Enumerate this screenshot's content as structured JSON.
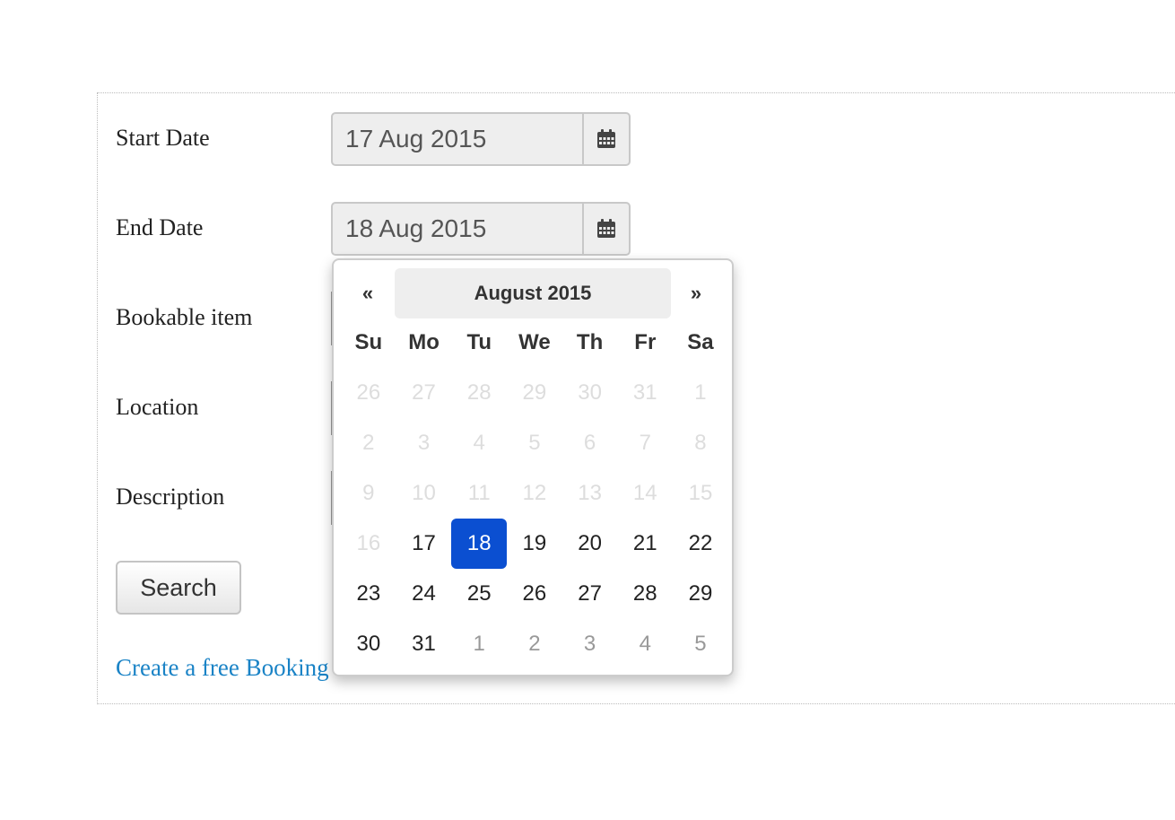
{
  "form": {
    "start_date_label": "Start Date",
    "start_date_value": "17 Aug 2015",
    "end_date_label": "End Date",
    "end_date_value": "18 Aug 2015",
    "bookable_item_label": "Bookable item",
    "location_label": "Location",
    "description_label": "Description",
    "search_label": "Search",
    "create_link_text": "Create a free Booking"
  },
  "datepicker": {
    "prev": "«",
    "next": "»",
    "month_title": "August 2015",
    "days_of_week": [
      "Su",
      "Mo",
      "Tu",
      "We",
      "Th",
      "Fr",
      "Sa"
    ],
    "selected_day": "18",
    "accent_color": "#0b4fd1",
    "weeks": [
      [
        {
          "d": "26",
          "s": "disabled"
        },
        {
          "d": "27",
          "s": "disabled"
        },
        {
          "d": "28",
          "s": "disabled"
        },
        {
          "d": "29",
          "s": "disabled"
        },
        {
          "d": "30",
          "s": "disabled"
        },
        {
          "d": "31",
          "s": "disabled"
        },
        {
          "d": "1",
          "s": "disabled"
        }
      ],
      [
        {
          "d": "2",
          "s": "disabled"
        },
        {
          "d": "3",
          "s": "disabled"
        },
        {
          "d": "4",
          "s": "disabled"
        },
        {
          "d": "5",
          "s": "disabled"
        },
        {
          "d": "6",
          "s": "disabled"
        },
        {
          "d": "7",
          "s": "disabled"
        },
        {
          "d": "8",
          "s": "disabled"
        }
      ],
      [
        {
          "d": "9",
          "s": "disabled"
        },
        {
          "d": "10",
          "s": "disabled"
        },
        {
          "d": "11",
          "s": "disabled"
        },
        {
          "d": "12",
          "s": "disabled"
        },
        {
          "d": "13",
          "s": "disabled"
        },
        {
          "d": "14",
          "s": "disabled"
        },
        {
          "d": "15",
          "s": "disabled"
        }
      ],
      [
        {
          "d": "16",
          "s": "disabled"
        },
        {
          "d": "17",
          "s": "day"
        },
        {
          "d": "18",
          "s": "active"
        },
        {
          "d": "19",
          "s": "day"
        },
        {
          "d": "20",
          "s": "day"
        },
        {
          "d": "21",
          "s": "day"
        },
        {
          "d": "22",
          "s": "day"
        }
      ],
      [
        {
          "d": "23",
          "s": "day"
        },
        {
          "d": "24",
          "s": "day"
        },
        {
          "d": "25",
          "s": "day"
        },
        {
          "d": "26",
          "s": "day"
        },
        {
          "d": "27",
          "s": "day"
        },
        {
          "d": "28",
          "s": "day"
        },
        {
          "d": "29",
          "s": "day"
        }
      ],
      [
        {
          "d": "30",
          "s": "day"
        },
        {
          "d": "31",
          "s": "day"
        },
        {
          "d": "1",
          "s": "new"
        },
        {
          "d": "2",
          "s": "new"
        },
        {
          "d": "3",
          "s": "new"
        },
        {
          "d": "4",
          "s": "new"
        },
        {
          "d": "5",
          "s": "new"
        }
      ]
    ]
  }
}
